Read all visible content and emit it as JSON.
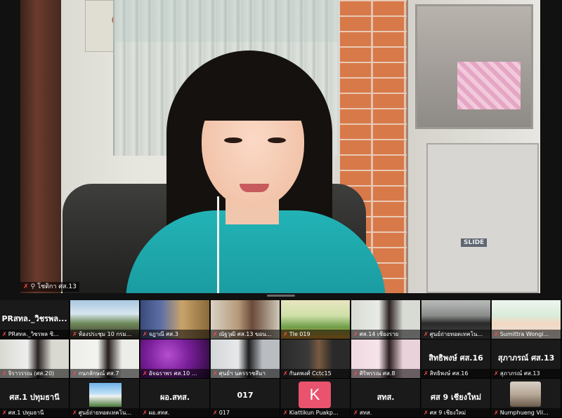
{
  "speaker": {
    "name": "โชติกา ศส.13",
    "cabinet_label": "SLIDE"
  },
  "gallery": {
    "row1": [
      {
        "big": "PRสทล._วิชรพล...",
        "label": "PRสทล._วิชรพล ซิ..."
      },
      {
        "big": "",
        "label": "ห้องประชุม 10 กรม..."
      },
      {
        "big": "",
        "label": "จฎาณี ศส.3"
      },
      {
        "big": "",
        "label": "ณัฐวุฒิ ศส.13 ขอน..."
      },
      {
        "big": "",
        "label": "Tle 019"
      },
      {
        "big": "",
        "label": "ศส.14 เชียงราย"
      },
      {
        "big": "",
        "label": "ศูนย์ถ่ายทอดเทคโน..."
      },
      {
        "big": "",
        "label": "Sumittra Wongi..."
      }
    ],
    "row2": [
      {
        "big": "",
        "label": "จิราวรรณ (ศส.20)"
      },
      {
        "big": "",
        "label": "กนกลักษณ์ ศส.7"
      },
      {
        "big": "",
        "label": "อัจฉราพร ศส.10 ..."
      },
      {
        "big": "",
        "label": "ศุนย์ฯ นครราชสีมา"
      },
      {
        "big": "",
        "label": "กันตพงศ์ Cctc15"
      },
      {
        "big": "",
        "label": "ศิริพรรณ ศส.8"
      },
      {
        "big": "สิทธิพงษ์ ศส.16",
        "label": "สิทธิพงษ์ ศส.16"
      },
      {
        "big": "สุภาภรณ์ ศส.13",
        "label": "สุภาภรณ์ ศส.13"
      }
    ],
    "row3": [
      {
        "big": "ศส.1 ปทุมธานี",
        "label": "ศส.1 ปทุมธานี"
      },
      {
        "big": "",
        "label": "ศูนย์ถ่ายทอดเทคโน..."
      },
      {
        "big": "ผอ.สทส.",
        "label": "ผอ.สทส."
      },
      {
        "big": "017",
        "label": "017"
      },
      {
        "big": "",
        "label": "Kiattikun Puakp..."
      },
      {
        "big": "สทส.",
        "label": "สทส."
      },
      {
        "big": "ศส 9 เชียงใหม่",
        "label": "ศส 9 เชียงใหม่"
      },
      {
        "big": "",
        "label": "Numphueng Vil..."
      }
    ],
    "avatar_letter": "K"
  },
  "colors": {
    "background": "#0f0f0f",
    "mic_muted": "#ff4d4d",
    "avatar_k": "#e9536e",
    "shirt": "#22b3b6"
  }
}
